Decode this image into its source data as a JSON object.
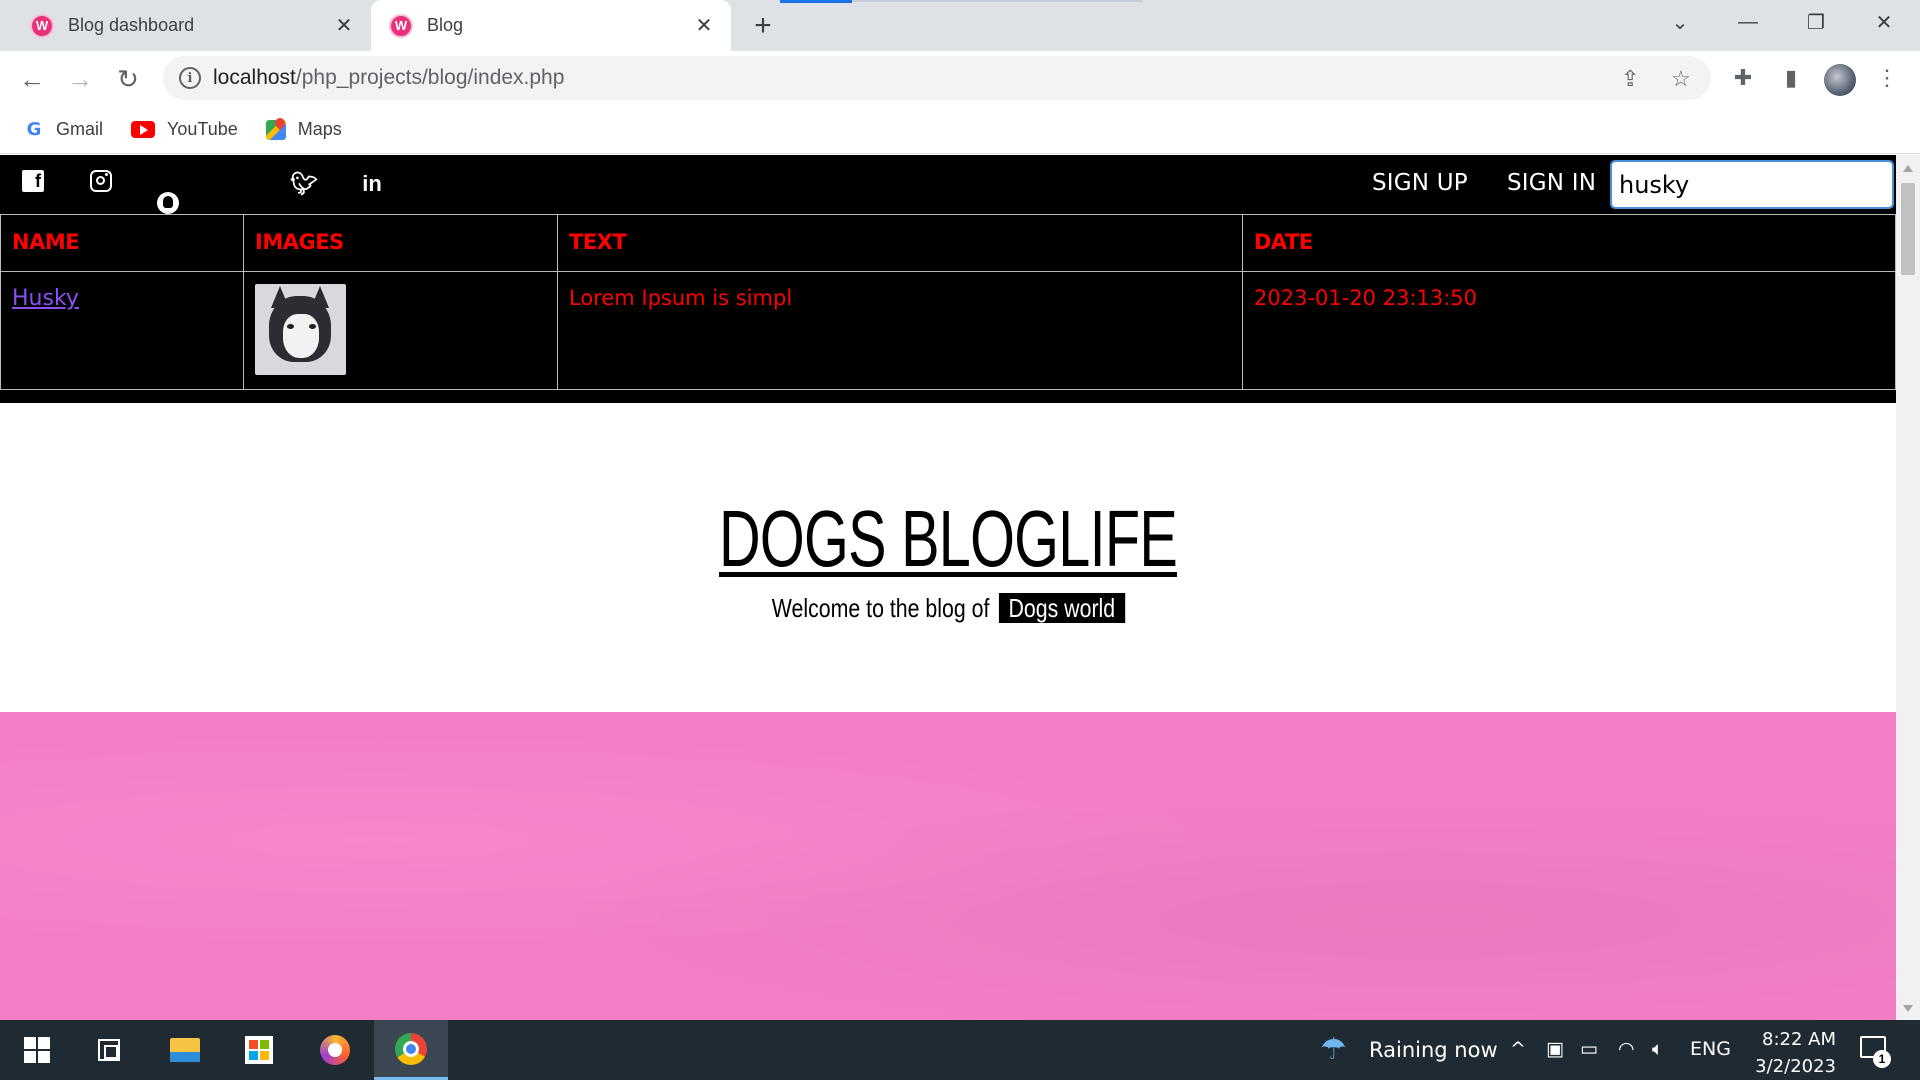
{
  "browser": {
    "tabs": [
      {
        "title": "Blog dashboard",
        "active": false
      },
      {
        "title": "Blog",
        "active": true
      }
    ],
    "url_host": "localhost",
    "url_path": "/php_projects/blog/index.php",
    "bookmarks": [
      {
        "label": "Gmail",
        "icon": "google-icon"
      },
      {
        "label": "YouTube",
        "icon": "youtube-icon"
      },
      {
        "label": "Maps",
        "icon": "maps-icon"
      }
    ]
  },
  "site": {
    "social_icons": [
      "facebook-icon",
      "instagram-icon",
      "snapchat-icon",
      "flickr-icon",
      "twitter-icon",
      "linkedin-icon"
    ],
    "nav": {
      "sign_up": "SIGN UP",
      "sign_in": "SIGN IN"
    },
    "search_value": "husky",
    "results": {
      "headers": [
        "NAME",
        "IMAGES",
        "TEXT",
        "DATE"
      ],
      "rows": [
        {
          "name": "Husky",
          "text": "Lorem Ipsum is simpl",
          "date": "2023-01-20 23:13:50"
        }
      ]
    },
    "hero": {
      "title": "DOGS BLOGLIFE",
      "tagline_prefix": "Welcome to the blog of",
      "tagline_highlight": "Dogs world"
    },
    "colors": {
      "table_text": "#ff0000",
      "link": "#8a4ff0",
      "band": "#f47ec6"
    }
  },
  "taskbar": {
    "weather": "Raining now",
    "language": "ENG",
    "time": "8:22 AM",
    "date": "3/2/2023",
    "notification_count": "1"
  }
}
